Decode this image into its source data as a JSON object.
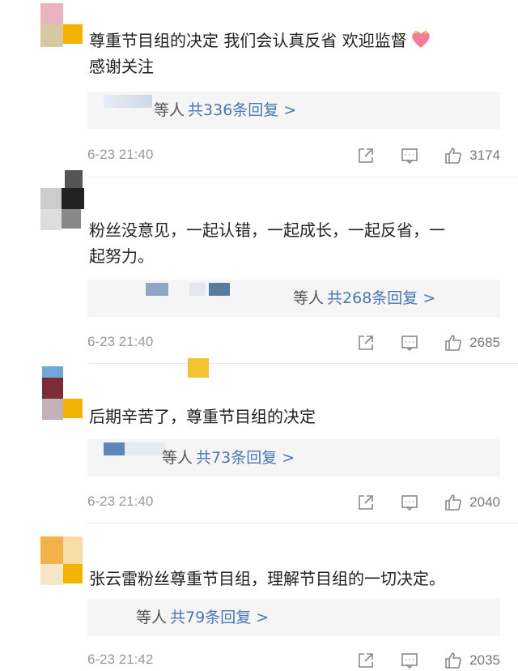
{
  "comments": [
    {
      "text": "尊重节目组的决定 我们会认真反省 欢迎监督",
      "text2": "感谢关注",
      "has_heart": true,
      "reply_people": "等人",
      "reply_link": "共336条回复 >",
      "time": "6-23 21:40",
      "likes": "3174",
      "avatar_colors": [
        "#e8b4c0",
        "#d4c9a0",
        "#f2b400"
      ]
    },
    {
      "text": "粉丝没意见，一起认错，一起成长，一起反省，一",
      "text2": "起努力。",
      "has_heart": false,
      "reply_people": "等人",
      "reply_link": "共268条回复 >",
      "time": "6-23 21:40",
      "likes": "2685",
      "avatar_colors": [
        "#222222",
        "#888888",
        "#dddddd"
      ]
    },
    {
      "text": "后期辛苦了，尊重节目组的决定",
      "text2": "",
      "has_heart": false,
      "reply_people": "等人",
      "reply_link": "共73条回复 >",
      "time": "6-23 21:40",
      "likes": "2040",
      "avatar_colors": [
        "#7a2d35",
        "#c4b0b8",
        "#f2b400"
      ]
    },
    {
      "text": "张云雷粉丝尊重节目组，理解节目组的一切决定。",
      "text2": "",
      "has_heart": false,
      "reply_people": "等人",
      "reply_link": "共79条回复 >",
      "time": "6-23 21:42",
      "likes": "2035",
      "avatar_colors": [
        "#f2b24a",
        "#f6dca8",
        "#f2b400"
      ]
    }
  ],
  "colors": {
    "link": "#4a77b3",
    "meta": "#999999",
    "reply_bg": "#f5f5f5",
    "badge": "#f2b400"
  },
  "icons": [
    "share-icon",
    "comment-icon",
    "like-icon"
  ]
}
